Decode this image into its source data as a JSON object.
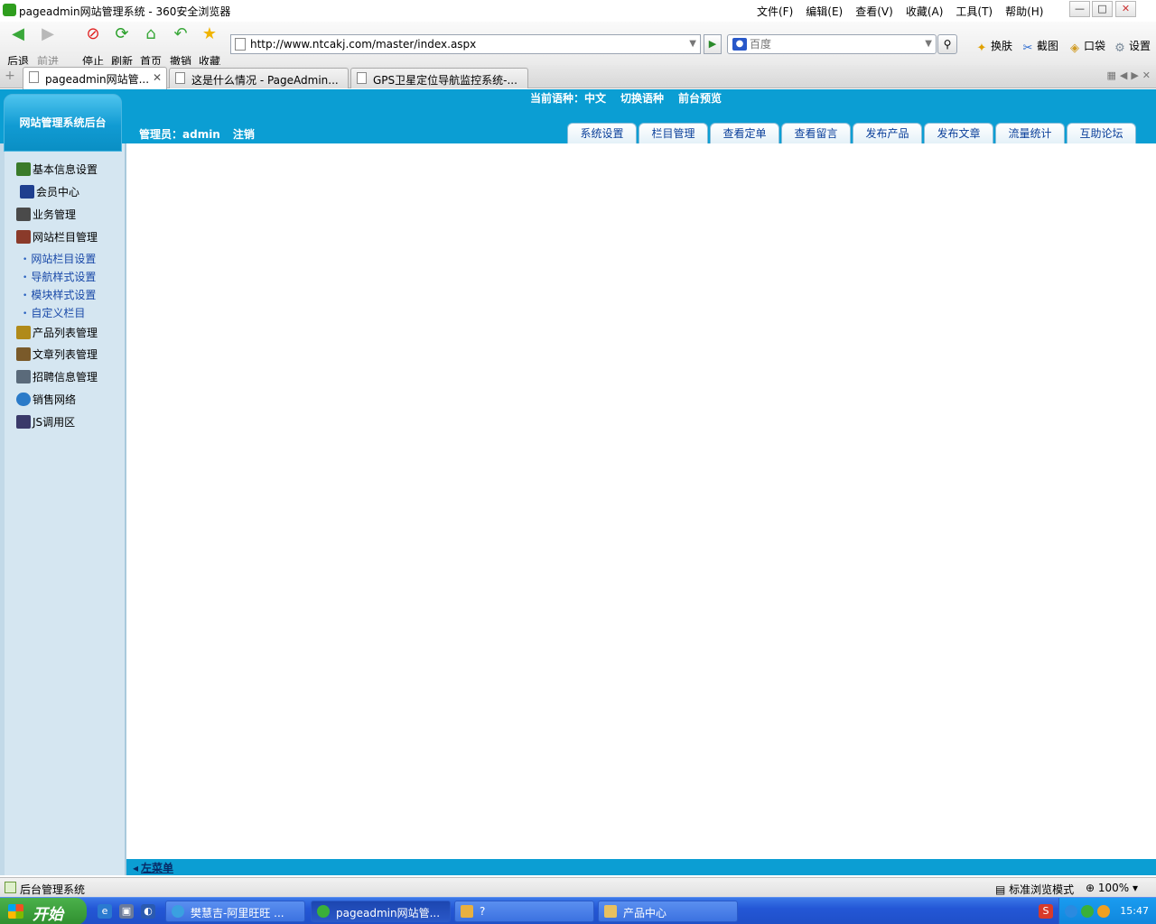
{
  "window": {
    "title": "pageadmin网站管理系统 - 360安全浏览器",
    "menus": [
      "文件(F)",
      "编辑(E)",
      "查看(V)",
      "收藏(A)",
      "工具(T)",
      "帮助(H)"
    ]
  },
  "toolbar": {
    "back": "后退",
    "forward": "前进",
    "stop": "停止",
    "refresh": "刷新",
    "home": "首页",
    "undo": "撤销",
    "favorite": "收藏",
    "address": "http://www.ntcakj.com/master/index.aspx",
    "search_placeholder": "百度",
    "skin": "换肤",
    "screenshot": "截图",
    "pocket": "口袋",
    "settings": "设置"
  },
  "tabs": [
    {
      "label": "pageadmin网站管..."
    },
    {
      "label": "这是什么情况 - PageAdmin..."
    },
    {
      "label": "GPS卫星定位导航监控系统-..."
    }
  ],
  "admin": {
    "logo_text": "网站管理系统后台",
    "language_label": "当前语种：中文",
    "switch_language": "切换语种",
    "preview": "前台预览",
    "user_label": "管理员：admin",
    "logout": "注销",
    "nav_tabs": [
      "系统设置",
      "栏目管理",
      "查看定单",
      "查看留言",
      "发布产品",
      "发布文章",
      "流量统计",
      "互助论坛"
    ]
  },
  "sidebar": {
    "items": [
      {
        "label": "基本信息设置",
        "icon": "info-settings-icon",
        "color": "#3a7a2a"
      },
      {
        "label": "会员中心",
        "icon": "members-icon",
        "color": "#1f3f8f"
      },
      {
        "label": "业务管理",
        "icon": "business-icon",
        "color": "#4a4a4a"
      },
      {
        "label": "网站栏目管理",
        "icon": "tools-icon",
        "color": "#8a3a2a"
      },
      {
        "label": "产品列表管理",
        "icon": "products-icon",
        "color": "#b08a1a"
      },
      {
        "label": "文章列表管理",
        "icon": "articles-icon",
        "color": "#7a5a2a"
      },
      {
        "label": "招聘信息管理",
        "icon": "jobs-icon",
        "color": "#5a6a7a"
      },
      {
        "label": "销售网络",
        "icon": "network-globe-icon",
        "color": "#2a7ac8"
      },
      {
        "label": "JS调用区",
        "icon": "computer-icon",
        "color": "#3a3a6a"
      }
    ],
    "sub_items": [
      "网站栏目设置",
      "导航样式设置",
      "模块样式设置",
      "自定义栏目"
    ]
  },
  "left_menu_toggle": "左菜单",
  "status": {
    "text": "后台管理系统",
    "mode": "标准浏览模式",
    "zoom": "100%"
  },
  "taskbar": {
    "start": "开始",
    "tasks": [
      {
        "label": "樊慧吉-阿里旺旺 ..."
      },
      {
        "label": "pageadmin网站管..."
      },
      {
        "label": "?"
      },
      {
        "label": "产品中心"
      }
    ],
    "clock": "15:47"
  }
}
